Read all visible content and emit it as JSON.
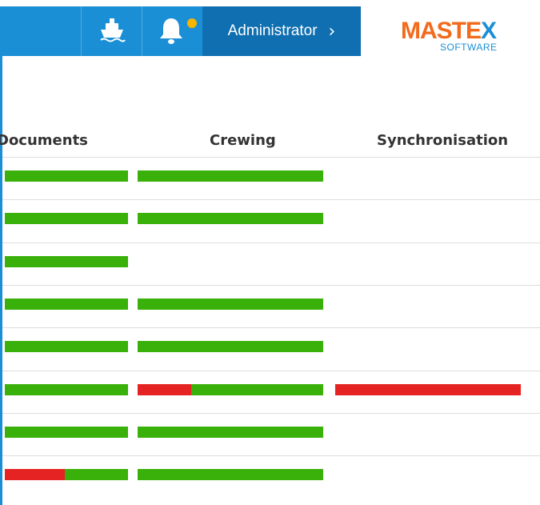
{
  "header": {
    "ship_icon": "ship-icon",
    "bell_icon": "bell-icon",
    "user_label": "Administrator",
    "chevron": "›",
    "logo": {
      "main": "MASTEX",
      "sub": "SOFTWARE"
    }
  },
  "columns": [
    "Documents",
    "Crewing",
    "Synchronisation"
  ],
  "colors": {
    "ok": "#39b10a",
    "error": "#e62323",
    "brand": "#1b8fd5",
    "logo": "#f26a1b",
    "notify": "#f7b500"
  },
  "rows": [
    {
      "documents": {
        "error": 0.0
      },
      "crewing": {
        "error": 0.0
      },
      "synchronisation": null
    },
    {
      "documents": {
        "error": 0.0
      },
      "crewing": {
        "error": 0.0
      },
      "synchronisation": null
    },
    {
      "documents": {
        "error": 0.0
      },
      "crewing": null,
      "synchronisation": null
    },
    {
      "documents": {
        "error": 0.0
      },
      "crewing": {
        "error": 0.0
      },
      "synchronisation": null
    },
    {
      "documents": {
        "error": 0.0
      },
      "crewing": {
        "error": 0.0
      },
      "synchronisation": null
    },
    {
      "documents": {
        "error": 0.0
      },
      "crewing": {
        "error": 0.29
      },
      "synchronisation": {
        "error": 1.0
      }
    },
    {
      "documents": {
        "error": 0.0
      },
      "crewing": {
        "error": 0.0
      },
      "synchronisation": null
    },
    {
      "documents": {
        "error": 0.49
      },
      "crewing": {
        "error": 0.0
      },
      "synchronisation": null
    }
  ]
}
